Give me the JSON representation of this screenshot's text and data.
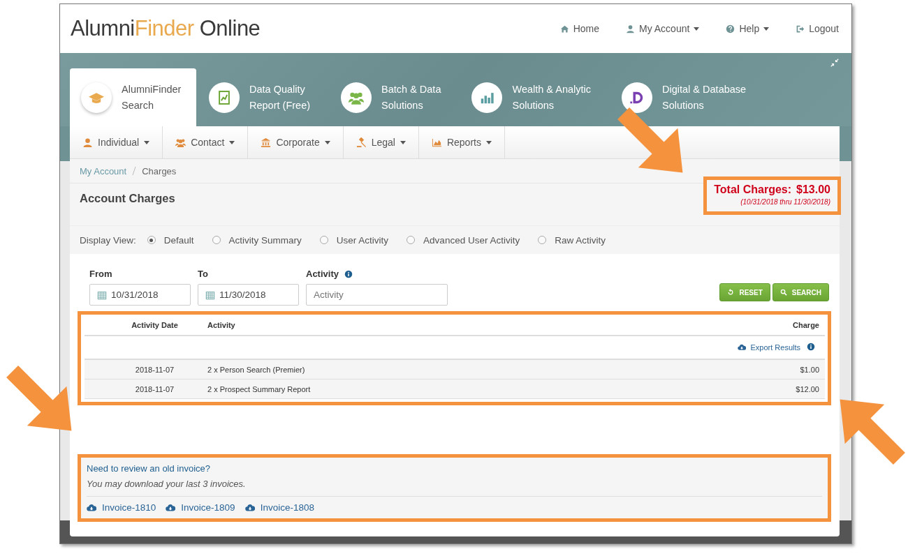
{
  "header": {
    "logo": [
      {
        "text": "Alumni",
        "kind": "dark"
      },
      {
        "text": "Finder",
        "kind": "accent"
      },
      {
        "text": " Online",
        "kind": "dark"
      }
    ],
    "nav": [
      {
        "label": "Home",
        "dropdown": false
      },
      {
        "label": "My Account",
        "dropdown": true
      },
      {
        "label": "Help",
        "dropdown": true
      },
      {
        "label": "Logout",
        "dropdown": false
      }
    ]
  },
  "product_tabs": [
    {
      "label": "AlumniFinder\nSearch",
      "selected": true
    },
    {
      "label": "Data Quality\nReport (Free)",
      "selected": false
    },
    {
      "label": "Batch & Data\nSolutions",
      "selected": false
    },
    {
      "label": "Wealth & Analytic\nSolutions",
      "selected": false
    },
    {
      "label": "Digital & Database\nSolutions",
      "selected": false
    }
  ],
  "menu": [
    "Individual",
    "Contact",
    "Corporate",
    "Legal",
    "Reports"
  ],
  "breadcrumb": [
    "My Account",
    "Charges"
  ],
  "page_title": "Account Charges",
  "total": {
    "label": "Total Charges:",
    "amount": "$13.00",
    "period": "(10/31/2018 thru 11/30/2018)"
  },
  "display_view": {
    "label": "Display View:",
    "options": [
      {
        "label": "Default",
        "selected": true
      },
      {
        "label": "Activity Summary",
        "selected": false
      },
      {
        "label": "User Activity",
        "selected": false
      },
      {
        "label": "Advanced User Activity",
        "selected": false
      },
      {
        "label": "Raw Activity",
        "selected": false
      }
    ]
  },
  "filters": {
    "from": {
      "label": "From",
      "value": "10/31/2018"
    },
    "to": {
      "label": "To",
      "value": "11/30/2018"
    },
    "activity": {
      "label": "Activity",
      "placeholder": "Activity"
    },
    "buttons": [
      "RESET",
      "SEARCH"
    ]
  },
  "table": {
    "columns": [
      "Activity Date",
      "Activity",
      "Charge"
    ],
    "export": "Export Results",
    "rows": [
      [
        "2018-11-07",
        "2 x Person Search (Premier)",
        "$1.00"
      ],
      [
        "2018-11-07",
        "2 x Prospect Summary Report",
        "$12.00"
      ]
    ]
  },
  "invoices": {
    "title": "Need to review an old invoice?",
    "note": "You may download your last 3 invoices.",
    "links": [
      "Invoice-1810",
      "Invoice-1809",
      "Invoice-1808"
    ]
  }
}
